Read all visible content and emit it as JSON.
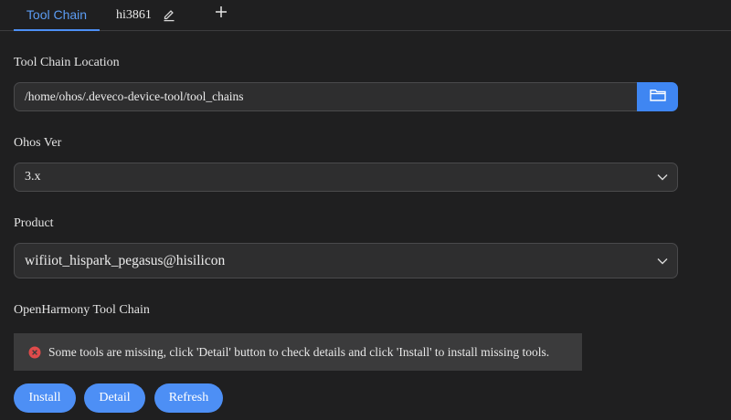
{
  "tabs": [
    {
      "label": "Tool Chain",
      "active": true
    },
    {
      "label": "hi3861",
      "active": false
    }
  ],
  "icons": {
    "edit": "pencil-icon",
    "add": "plus-icon",
    "browse": "folder-icon",
    "dropdown": "chevron-down-icon",
    "error": "error-circle-icon"
  },
  "toolchain_location": {
    "label": "Tool Chain Location",
    "value": "/home/ohos/.deveco-device-tool/tool_chains"
  },
  "ohos_ver": {
    "label": "Ohos Ver",
    "value": "3.x"
  },
  "product": {
    "label": "Product",
    "value": "wifiiot_hispark_pegasus@hisilicon"
  },
  "openharmony_toolchain": {
    "label": "OpenHarmony Tool Chain",
    "alert": "Some tools are missing, click 'Detail' button to check details and click 'Install' to install missing tools."
  },
  "buttons": {
    "install": "Install",
    "detail": "Detail",
    "refresh": "Refresh"
  },
  "colors": {
    "accent": "#4d8ff5",
    "background": "#1f1f20",
    "error": "#e04b4b"
  }
}
